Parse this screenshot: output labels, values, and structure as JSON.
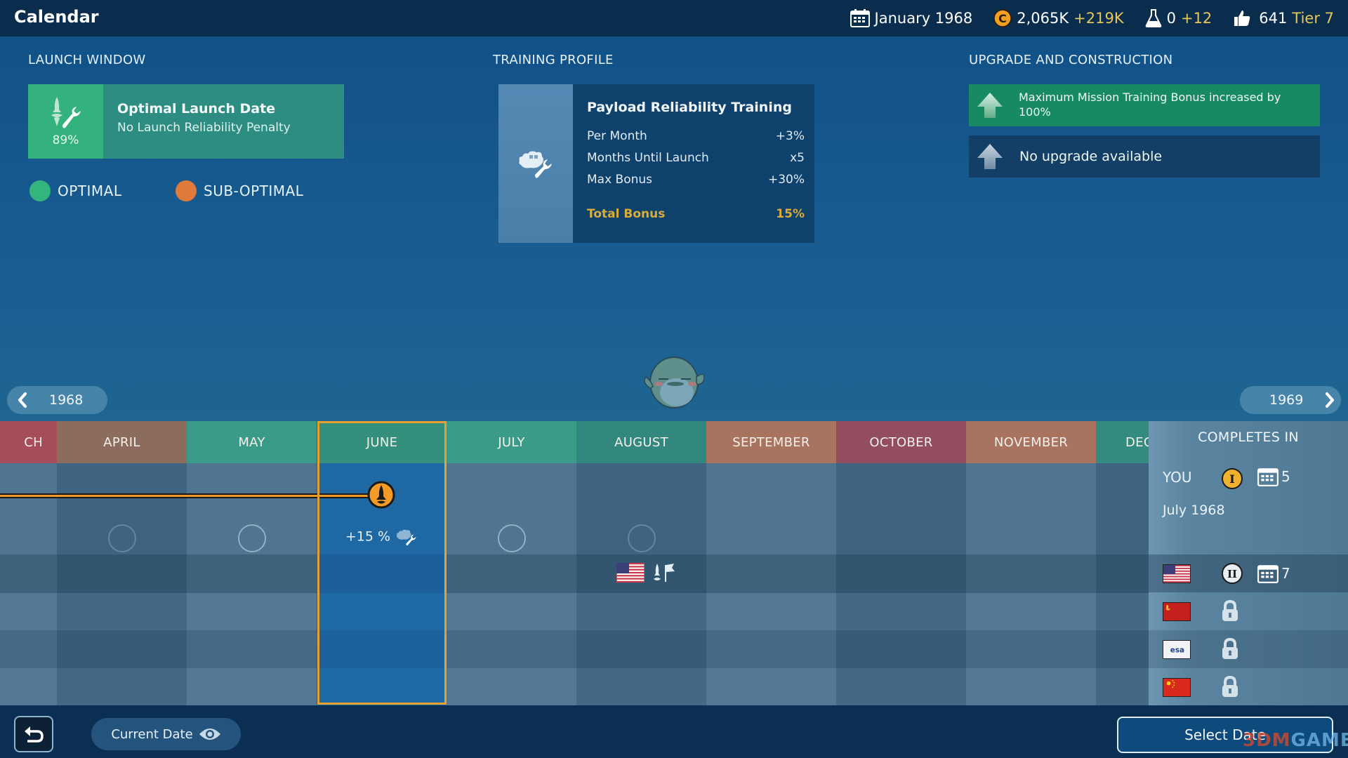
{
  "header": {
    "title": "Calendar",
    "date": "January 1968",
    "money": {
      "value": "2,065K",
      "delta": "+219K"
    },
    "science": {
      "value": "0",
      "delta": "+12"
    },
    "reputation": {
      "value": "641",
      "tier": "Tier 7"
    }
  },
  "launch_window": {
    "section_title": "LAUNCH WINDOW",
    "reliability_percent": "89%",
    "card_title": "Optimal Launch Date",
    "card_subtitle": "No Launch Reliability Penalty",
    "legend": [
      {
        "label": "OPTIMAL",
        "color": "#35b57e"
      },
      {
        "label": "SUB-OPTIMAL",
        "color": "#e07a3a"
      }
    ]
  },
  "training_profile": {
    "section_title": "TRAINING PROFILE",
    "card_title": "Payload Reliability Training",
    "rows": [
      {
        "label": "Per Month",
        "value": "+3%"
      },
      {
        "label": "Months Until Launch",
        "value": "x5"
      },
      {
        "label": "Max Bonus",
        "value": "+30%"
      }
    ],
    "total": {
      "label": "Total Bonus",
      "value": "15%"
    }
  },
  "upgrade": {
    "section_title": "UPGRADE AND CONSTRUCTION",
    "items": [
      {
        "text": "Maximum Mission Training Bonus increased by 100%",
        "state": "active"
      },
      {
        "text": "No upgrade available",
        "state": "inactive"
      }
    ]
  },
  "year_nav": {
    "prev": "1968",
    "next": "1969"
  },
  "calendar": {
    "months": [
      {
        "label": "MARCH",
        "display": "CH",
        "status": "sub-optimal-red",
        "color": "#a54d5a"
      },
      {
        "label": "APRIL",
        "display": "APRIL",
        "status": "sub-optimal",
        "color": "#8c6c5c"
      },
      {
        "label": "MAY",
        "display": "MAY",
        "status": "optimal",
        "color": "#3a9c88"
      },
      {
        "label": "JUNE",
        "display": "JUNE",
        "status": "optimal",
        "color": "#34907c",
        "selected": true
      },
      {
        "label": "JULY",
        "display": "JULY",
        "status": "optimal",
        "color": "#3a9c88"
      },
      {
        "label": "AUGUST",
        "display": "AUGUST",
        "status": "optimal",
        "color": "#32887e"
      },
      {
        "label": "SEPTEMBER",
        "display": "SEPTEMBER",
        "status": "sub-optimal",
        "color": "#a87460"
      },
      {
        "label": "OCTOBER",
        "display": "OCTOBER",
        "status": "sub-optimal-red",
        "color": "#924d60"
      },
      {
        "label": "NOVEMBER",
        "display": "NOVEMBER",
        "status": "sub-optimal",
        "color": "#a87460"
      },
      {
        "label": "DECEMBER",
        "display": "DEC",
        "status": "optimal",
        "color": "#338a7e"
      }
    ],
    "selected_bonus": "+15 %"
  },
  "completes_in": {
    "title": "COMPLETES IN",
    "you_label": "YOU",
    "you_stage": "I",
    "you_months": "5",
    "you_date": "July 1968",
    "rivals": [
      {
        "flag": "usa",
        "status": "stage",
        "stage": "II",
        "months": "7"
      },
      {
        "flag": "ussr",
        "status": "locked"
      },
      {
        "flag": "esa",
        "status": "locked",
        "flag_text": "esa"
      },
      {
        "flag": "china",
        "status": "locked"
      }
    ]
  },
  "footer": {
    "current_date_label": "Current Date",
    "select_date_label": "Select Date",
    "watermark_a": "3DM",
    "watermark_b": "GAME"
  }
}
